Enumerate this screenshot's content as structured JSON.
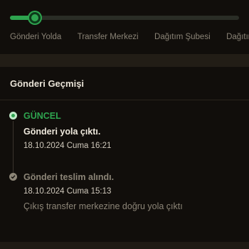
{
  "progress": {
    "fraction": 0.11,
    "color": "#2ea44f",
    "steps": [
      "Gönderi Yolda",
      "Transfer Merkezi",
      "Dağıtım Şubesi",
      "Dağıtım"
    ]
  },
  "history": {
    "title": "Gönderi Geçmişi",
    "events": [
      {
        "status": "GÜNCEL",
        "title": "Gönderi yola çıktı.",
        "time": "18.10.2024 Cuma 16:21",
        "icon": "current-dot-icon"
      },
      {
        "title": "Gönderi teslim alındı.",
        "time": "18.10.2024 Cuma 15:13",
        "description": "Çıkış transfer merkezine doğru yola çıktı",
        "icon": "check-circle-icon"
      }
    ]
  }
}
